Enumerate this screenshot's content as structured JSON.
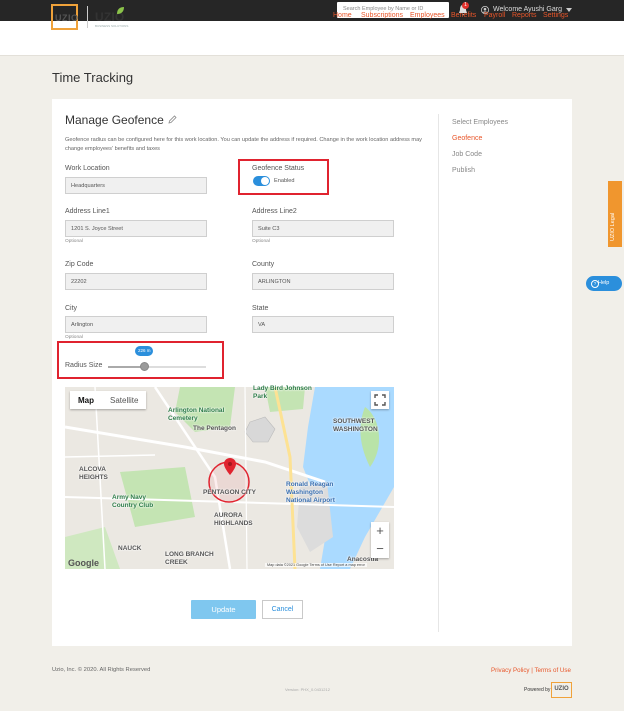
{
  "topbar": {
    "search_placeholder": "Search Employee by Name or ID",
    "notification_count": "1",
    "welcome": "Welcome Ayushi Garg"
  },
  "header": {
    "logo_left": "UZIO",
    "logo_right": "UZIO",
    "logo_right_sub": "BUSINESS SOLUTIONS",
    "nav": [
      "Home",
      "Subscriptions",
      "Employees",
      "Benefits",
      "Payroll",
      "Reports",
      "Settings"
    ]
  },
  "page": {
    "title": "Time Tracking"
  },
  "geofence": {
    "title": "Manage Geofence",
    "description": "Geofence radius can be configured here for this work location. You can update the address if required. Change in the work location address may change employees' benefits and taxes",
    "work_location_label": "Work Location",
    "work_location_value": "Headquarters",
    "status_label": "Geofence Status",
    "status_value": "Enabled",
    "status_enabled": true,
    "address1_label": "Address Line1",
    "address1_value": "1201 S. Joyce Street",
    "address2_label": "Address Line2",
    "address2_value": "Suite C3",
    "optional": "Optional",
    "zip_label": "Zip Code",
    "zip_value": "22202",
    "county_label": "County",
    "county_value": "ARLINGTON",
    "city_label": "City",
    "city_value": "Arlington",
    "state_label": "State",
    "state_value": "VA",
    "radius_label": "Radius Size",
    "radius_value": "226 m",
    "radius_fraction": 0.37
  },
  "map": {
    "tab_map": "Map",
    "tab_satellite": "Satellite",
    "zoom_in": "+",
    "zoom_out": "−",
    "google": "Google",
    "attribution": "Map data ©2021 Google   Terms of Use   Report a map error",
    "labels": {
      "arlington_cemetery": "Arlington National Cemetery",
      "johnson_park": "Lady Bird Johnson Park",
      "pentagon": "The Pentagon",
      "south_washington": "SOUTHWEST WASHINGTON",
      "alcova": "ALCOVA HEIGHTS",
      "army_navy": "Army Navy Country Club",
      "pentagon_city": "PENTAGON CITY",
      "reagan": "Ronald Reagan Washington National Airport",
      "aurora": "AURORA HIGHLANDS",
      "nauck": "NAUCK",
      "long_branch": "LONG BRANCH CREEK",
      "anacostia": "Anacostia"
    }
  },
  "actions": {
    "update": "Update",
    "cancel": "Cancel"
  },
  "steps": {
    "items": [
      "Select Employees",
      "Geofence",
      "Job Code",
      "Publish"
    ],
    "active_index": 1
  },
  "side": {
    "legal_tab": "UZIO Legal",
    "help": "Help"
  },
  "footer": {
    "copyright": "Uzio, Inc. © 2020. All Rights Reserved",
    "links": "Privacy Policy | Terms of Use",
    "version": "Version: PHX_0.0431212",
    "powered_by": "Powered by",
    "powered_logo": "UZIO"
  },
  "colors": {
    "accent": "#e8562a",
    "primary": "#2b8fdc",
    "highlight_box": "#e0232f",
    "logo_orange": "#f0a23a"
  }
}
